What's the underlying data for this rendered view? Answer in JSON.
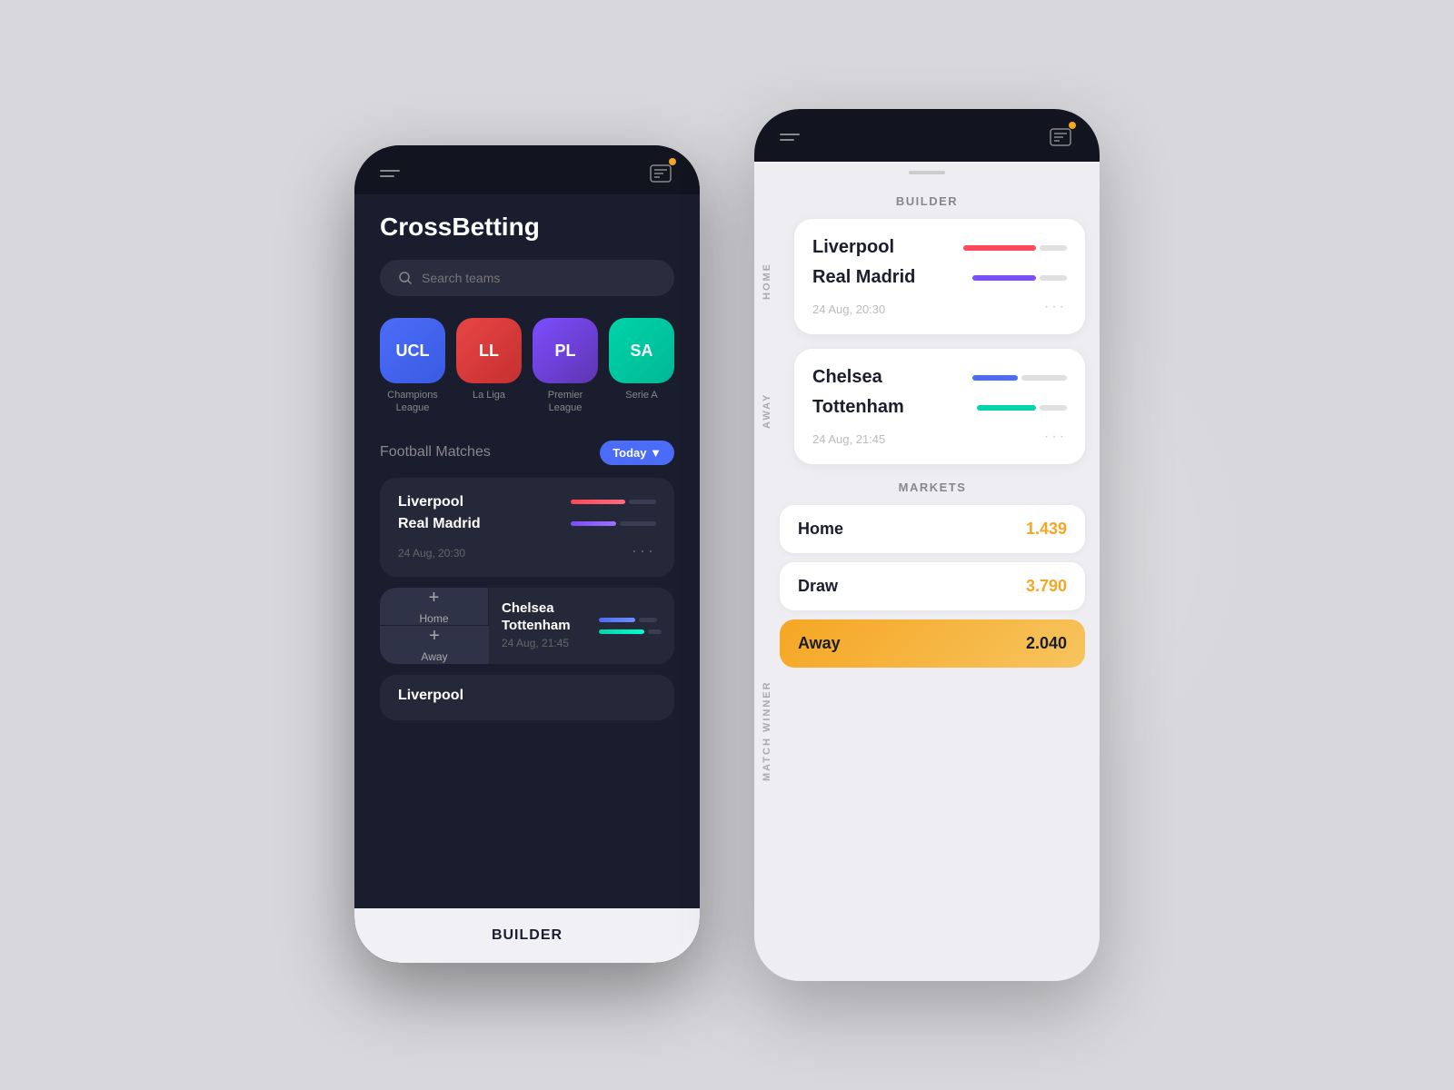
{
  "app": {
    "title": "CrossBetting"
  },
  "left_phone": {
    "search_placeholder": "Search teams",
    "leagues": [
      {
        "code": "UCL",
        "name": "Champions\nLeague",
        "class": "league-ucl"
      },
      {
        "code": "LL",
        "name": "La Liga",
        "class": "league-ll"
      },
      {
        "code": "PL",
        "name": "Premier\nLeague",
        "class": "league-pl"
      },
      {
        "code": "SA",
        "name": "Serie A",
        "class": "league-sa"
      }
    ],
    "section_title": "Football Matches",
    "today_label": "Today ▼",
    "matches": [
      {
        "team1": "Liverpool",
        "team2": "Real Madrid",
        "date": "24 Aug, 20:30"
      },
      {
        "team1": "Chelsea",
        "team2": "Tottenham",
        "date": "24 Aug, 21:45",
        "home_label": "Home",
        "away_label": "Away"
      }
    ],
    "partial_team": "Liverpool",
    "builder_label": "BUILDER"
  },
  "right_phone": {
    "builder_header": "BUILDER",
    "home_label": "HOME",
    "away_label": "AWAY",
    "match_winner_label": "MATCH WINNER",
    "matches": [
      {
        "team1": "Liverpool",
        "team2": "Real Madrid",
        "date": "24 Aug, 20:30"
      },
      {
        "team1": "Chelsea",
        "team2": "Tottenham",
        "date": "24 Aug, 21:45"
      }
    ],
    "markets_header": "MARKETS",
    "markets": [
      {
        "label": "Home",
        "odds": "1.439",
        "active": false
      },
      {
        "label": "Draw",
        "odds": "3.790",
        "active": false
      },
      {
        "label": "Away",
        "odds": "2.040",
        "active": true
      }
    ]
  }
}
